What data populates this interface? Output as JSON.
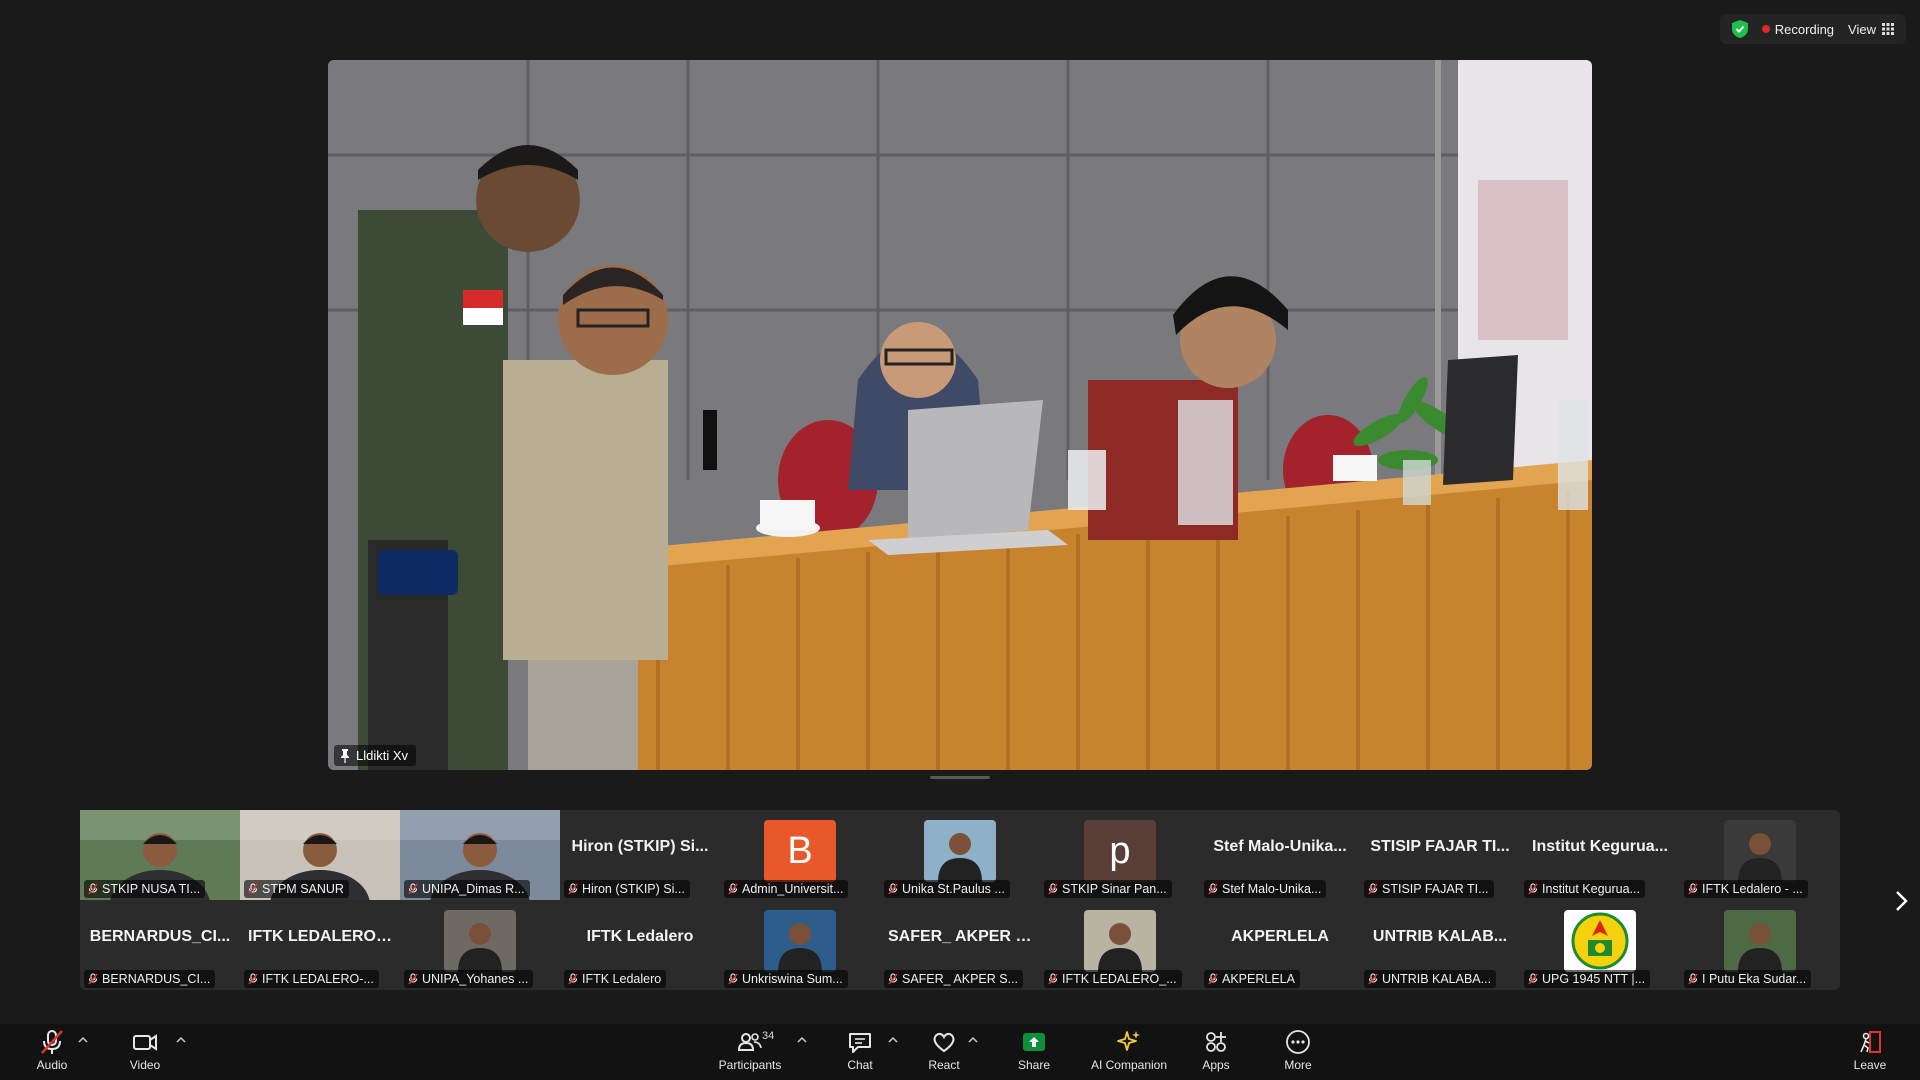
{
  "status": {
    "recording_label": "Recording",
    "view_label": "View"
  },
  "main_video": {
    "speaker_name": "Lldikti Xv"
  },
  "gallery": {
    "row1": [
      {
        "name": "STKIP NUSA TI...",
        "kind": "photo",
        "tone": "#5f7a55"
      },
      {
        "name": "STPM SANUR",
        "kind": "photo",
        "tone": "#c9c2b8"
      },
      {
        "name": "UNIPA_Dimas R...",
        "kind": "photo",
        "tone": "#7c8a9c"
      },
      {
        "name": "Hiron (STKIP) Si...",
        "kind": "text",
        "big": "Hiron (STKIP) Si..."
      },
      {
        "name": "Admin_Universit...",
        "kind": "letter",
        "letter": "B",
        "color": "#e8582a"
      },
      {
        "name": "Unika St.Paulus ...",
        "kind": "avatar",
        "tone": "#8fb0c9"
      },
      {
        "name": "STKIP Sinar Pan...",
        "kind": "letter",
        "letter": "p",
        "color": "#5a3e38"
      },
      {
        "name": "Stef Malo-Unika...",
        "kind": "text",
        "big": "Stef  Malo-Unika..."
      },
      {
        "name": "STISIP FAJAR TI...",
        "kind": "text",
        "big": "STISIP FAJAR TI..."
      },
      {
        "name": "Institut Kegurua...",
        "kind": "text",
        "big": "Institut  Kegurua..."
      },
      {
        "name": "IFTK Ledalero - ...",
        "kind": "avatar",
        "tone": "#3a3a3a"
      }
    ],
    "row2": [
      {
        "name": "BERNARDUS_CI...",
        "kind": "text",
        "big": "BERNARDUS_CI..."
      },
      {
        "name": "IFTK LEDALERO-...",
        "kind": "text",
        "big": "IFTK  LEDALERO-..."
      },
      {
        "name": "UNIPA_Yohanes ...",
        "kind": "avatar",
        "tone": "#6e6a63"
      },
      {
        "name": "IFTK Ledalero",
        "kind": "text",
        "big": "IFTK Ledalero"
      },
      {
        "name": "Unkriswina Sum...",
        "kind": "avatar",
        "tone": "#2d5d8a"
      },
      {
        "name": "SAFER_ AKPER S...",
        "kind": "text",
        "big": "SAFER_  AKPER S..."
      },
      {
        "name": "IFTK LEDALERO_...",
        "kind": "avatar",
        "tone": "#b9b3a3"
      },
      {
        "name": "AKPERLELA",
        "kind": "text",
        "big": "AKPERLELA"
      },
      {
        "name": "UNTRIB KALABA...",
        "kind": "text",
        "big": "UNTRIB KALAB..."
      },
      {
        "name": "UPG 1945 NTT |...",
        "kind": "logo"
      },
      {
        "name": "I Putu Eka Sudar...",
        "kind": "avatar",
        "tone": "#4e6a45"
      }
    ]
  },
  "toolbar": {
    "audio": "Audio",
    "video": "Video",
    "participants": "Participants",
    "participants_count": "34",
    "chat": "Chat",
    "react": "React",
    "share": "Share",
    "ai_companion": "AI Companion",
    "apps": "Apps",
    "more": "More",
    "leave": "Leave"
  },
  "colors": {
    "share_green": "#0e8f3b",
    "recording_red": "#e02828",
    "shield_green": "#1fbf4b",
    "leave_red": "#e03131"
  }
}
